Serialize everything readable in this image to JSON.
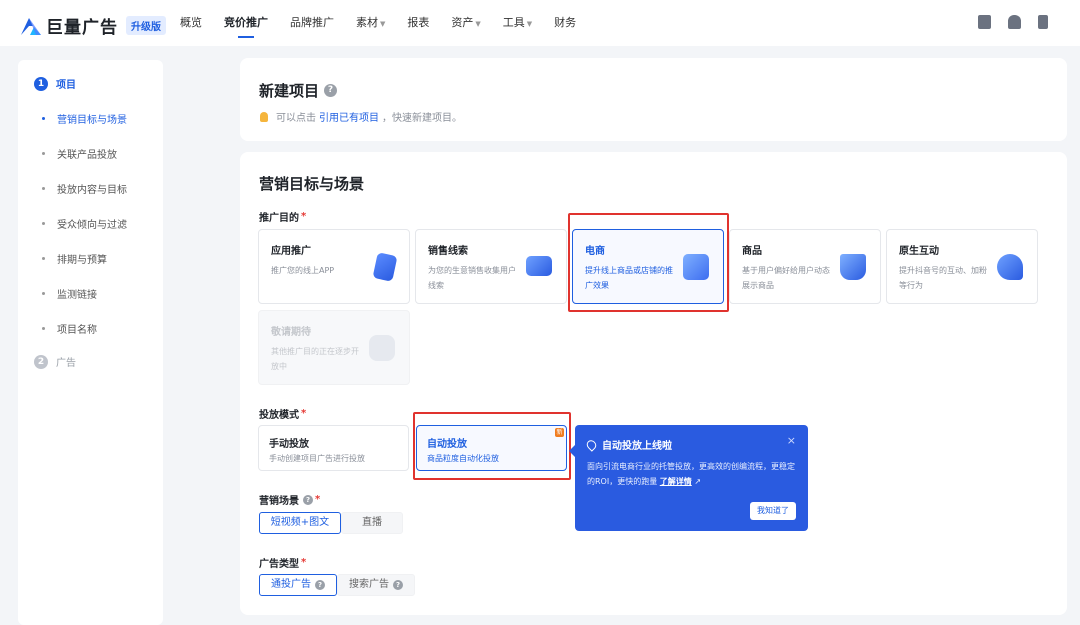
{
  "header": {
    "logo_text": "巨量广告",
    "logo_badge": "升级版",
    "nav": [
      {
        "label": "概览",
        "caret": false
      },
      {
        "label": "竞价推广",
        "caret": false,
        "active": true
      },
      {
        "label": "品牌推广",
        "caret": false
      },
      {
        "label": "素材",
        "caret": true
      },
      {
        "label": "报表",
        "caret": false
      },
      {
        "label": "资产",
        "caret": true
      },
      {
        "label": "工具",
        "caret": true
      },
      {
        "label": "财务",
        "caret": false
      }
    ],
    "icons": [
      "document-icon",
      "bell-icon",
      "phone-icon"
    ]
  },
  "sidebar": {
    "step1": {
      "num": "1",
      "label": "项目"
    },
    "items": [
      {
        "label": "营销目标与场景"
      },
      {
        "label": "关联产品投放"
      },
      {
        "label": "投放内容与目标"
      },
      {
        "label": "受众倾向与过滤"
      },
      {
        "label": "排期与预算"
      },
      {
        "label": "监测链接"
      },
      {
        "label": "项目名称"
      }
    ],
    "step2": {
      "num": "2",
      "label": "广告"
    }
  },
  "new_project": {
    "title": "新建项目",
    "tip_prefix": "可以点击",
    "tip_link": "引用已有项目",
    "tip_suffix": "，快速新建项目。"
  },
  "marketing": {
    "title": "营销目标与场景",
    "purpose_label": "推广目的",
    "required_mark": "*",
    "purposes": [
      {
        "title": "应用推广",
        "desc": "推广您的线上APP",
        "icon": "phone-app-icon"
      },
      {
        "title": "销售线索",
        "desc": "为您的生意销售收集用户线索",
        "icon": "card-cursor-icon"
      },
      {
        "title": "电商",
        "desc": "提升线上商品或店铺的推广效果",
        "icon": "shopping-bag-icon",
        "selected": true
      },
      {
        "title": "商品",
        "desc": "基于用户偏好给用户动态展示商品",
        "icon": "cart-icon"
      },
      {
        "title": "原生互动",
        "desc": "提升抖音号的互动、加粉等行为",
        "icon": "douyin-heart-icon"
      },
      {
        "title": "敬请期待",
        "desc": "其他推广目的正在逐步开放中",
        "icon": "chat-bubble-icon",
        "disabled": true
      }
    ],
    "mode_label": "投放模式",
    "modes": [
      {
        "title": "手动投放",
        "desc": "手动创建项目广告进行投放"
      },
      {
        "title": "自动投放",
        "desc": "商品粒度自动化投放",
        "selected": true,
        "badge": "新"
      }
    ],
    "scene_label": "营销场景",
    "scenes": [
      {
        "label": "短视频+图文",
        "selected": true
      },
      {
        "label": "直播"
      }
    ],
    "adtype_label": "广告类型",
    "adtypes": [
      {
        "label": "通投广告",
        "selected": true
      },
      {
        "label": "搜索广告"
      }
    ],
    "help_glyph": "?"
  },
  "popover": {
    "title": "自动投放上线啦",
    "close": "×",
    "body": "面向引流电商行业的托管投放，更高效的创编流程，更稳定的ROI，更快的跑量",
    "link": "了解详情",
    "button": "我知道了"
  },
  "colors": {
    "accent": "#1f5fe0",
    "highlight": "#e0332e",
    "popover": "#2a5be0"
  }
}
